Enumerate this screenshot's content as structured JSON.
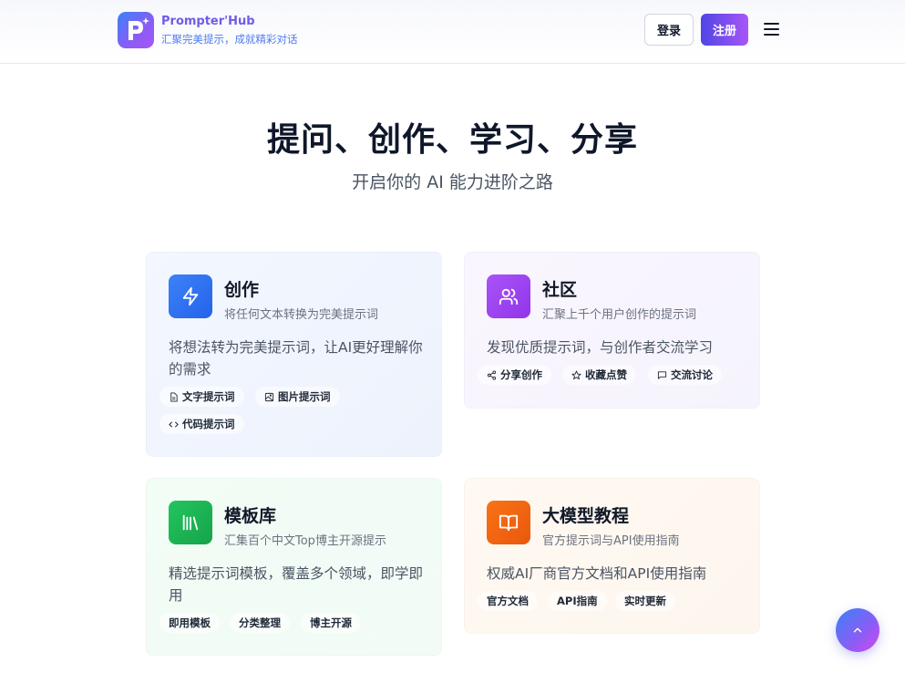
{
  "header": {
    "brand_name": "Prompter'Hub",
    "brand_tagline": "汇聚完美提示，成就精彩对话",
    "login_label": "登录",
    "register_label": "注册"
  },
  "hero": {
    "title": "提问、创作、学习、分享",
    "subtitle": "开启你的 AI 能力进阶之路"
  },
  "cards": {
    "create": {
      "title": "创作",
      "subtitle": "将任何文本转换为完美提示词",
      "description": "将想法转为完美提示词，让AI更好理解你的需求",
      "tags": [
        "文字提示词",
        "图片提示词",
        "代码提示词"
      ],
      "icon": "lightning-icon"
    },
    "community": {
      "title": "社区",
      "subtitle": "汇聚上千个用户创作的提示词",
      "description": "发现优质提示词，与创作者交流学习",
      "tags": [
        "分享创作",
        "收藏点赞",
        "交流讨论"
      ],
      "icon": "users-icon"
    },
    "template": {
      "title": "模板库",
      "subtitle": "汇集百个中文Top博主开源提示",
      "description": "精选提示词模板，覆盖多个领域，即学即用",
      "tags": [
        "即用模板",
        "分类整理",
        "博主开源"
      ],
      "icon": "library-icon"
    },
    "tutorial": {
      "title": "大模型教程",
      "subtitle": "官方提示词与API使用指南",
      "description": "权威AI厂商官方文档和API使用指南",
      "tags": [
        "官方文档",
        "API指南",
        "实时更新"
      ],
      "icon": "book-icon"
    }
  },
  "colors": {
    "brand": "#6d5ce8",
    "accent_blue": "#3b82f6",
    "accent_purple": "#a855f7",
    "accent_green": "#22c55e",
    "accent_orange": "#f97316"
  }
}
